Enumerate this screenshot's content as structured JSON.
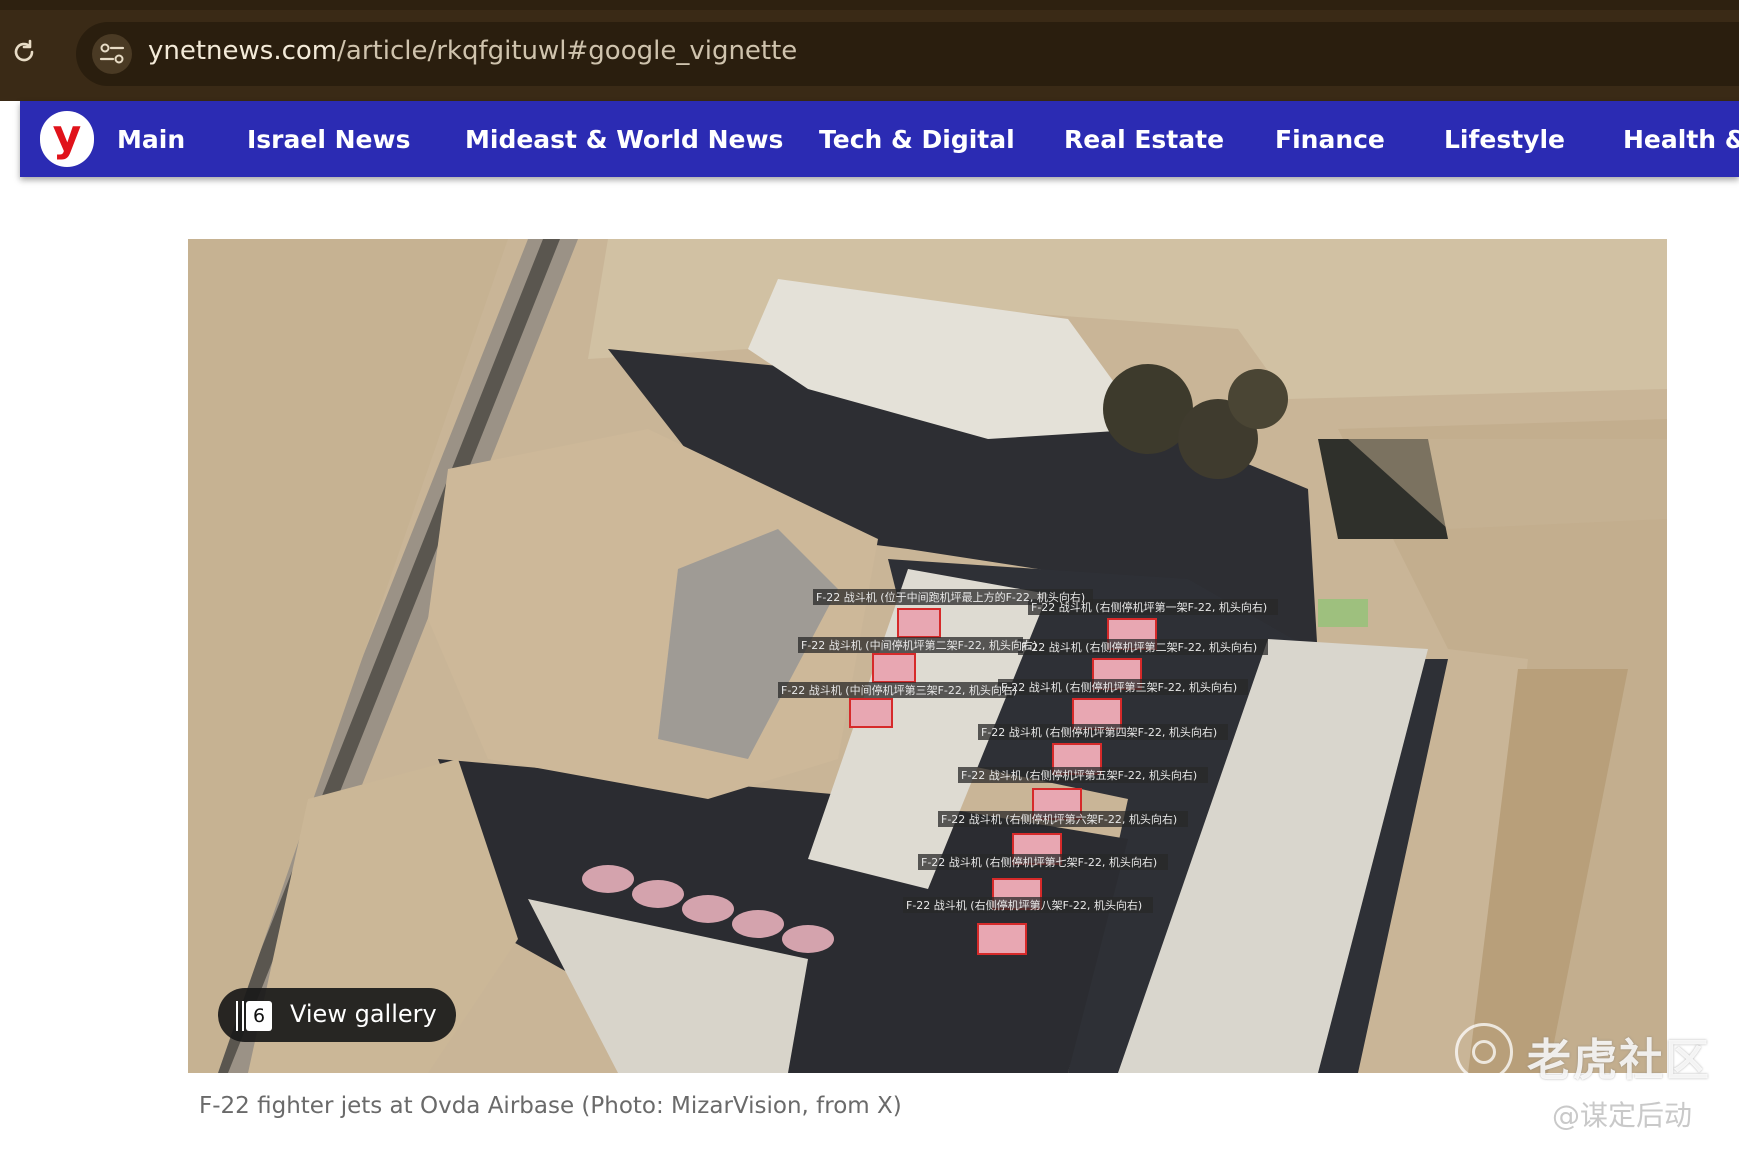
{
  "browser": {
    "url_domain": "ynetnews.com",
    "url_path": "/article/rkqfgituwl#google_vignette"
  },
  "nav": {
    "logo_letter": "y",
    "items": [
      {
        "label": "Main"
      },
      {
        "label": "Israel News"
      },
      {
        "label": "Mideast & World News"
      },
      {
        "label": "Tech & Digital"
      },
      {
        "label": "Real Estate"
      },
      {
        "label": "Finance"
      },
      {
        "label": "Lifestyle"
      },
      {
        "label": "Health &"
      }
    ]
  },
  "article": {
    "gallery_count": "6",
    "gallery_label": "View gallery",
    "caption": "F-22 fighter jets at Ovda Airbase  (Photo: MizarVision, from X)"
  },
  "photo_annotations": [
    "F-22 战斗机 (位于中间跑机坪最上方的F-22, 机头向右)",
    "F-22 战斗机 (右侧停机坪第一架F-22, 机头向右)",
    "F-22 战斗机 (中间停机坪第二架F-22, 机头向右)",
    "F-22 战斗机 (右侧停机坪第二架F-22, 机头向右)",
    "F-22 战斗机 (中间停机坪第三架F-22, 机头向右)",
    "F-22 战斗机 (右侧停机坪第三架F-22, 机头向右)",
    "F-22 战斗机 (右侧停机坪第四架F-22, 机头向右)",
    "F-22 战斗机 (右侧停机坪第五架F-22, 机头向右)",
    "F-22 战斗机 (右侧停机坪第六架F-22, 机头向右)",
    "F-22 战斗机 (右侧停机坪第七架F-22, 机头向右)",
    "F-22 战斗机 (右侧停机坪第八架F-22, 机头向右)"
  ],
  "watermark": {
    "brand": "老虎社区",
    "handle": "@谋定后动"
  },
  "colors": {
    "nav_bg": "#2b2bb3",
    "browser_bg": "#3a2a16",
    "logo_red": "#e0121a"
  },
  "icons": [
    "reload-icon",
    "site-info-icon",
    "gallery-icon"
  ]
}
